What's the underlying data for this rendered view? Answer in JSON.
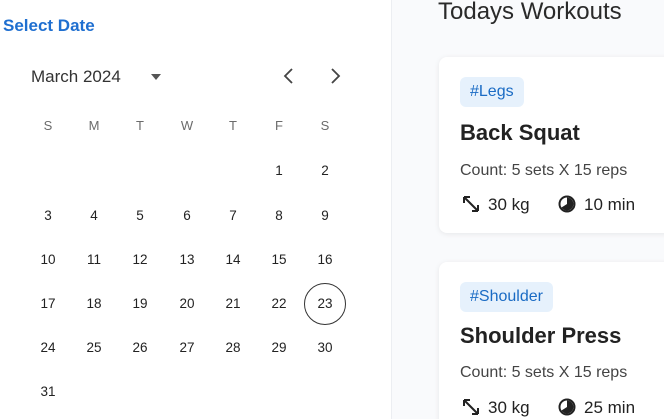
{
  "date_picker": {
    "heading": "Select Date",
    "month_label": "March 2024",
    "weekdays": [
      "S",
      "M",
      "T",
      "W",
      "T",
      "F",
      "S"
    ],
    "weeks": [
      [
        "",
        "",
        "",
        "",
        "",
        "1",
        "2"
      ],
      [
        "3",
        "4",
        "5",
        "6",
        "7",
        "8",
        "9"
      ],
      [
        "10",
        "11",
        "12",
        "13",
        "14",
        "15",
        "16"
      ],
      [
        "17",
        "18",
        "19",
        "20",
        "21",
        "22",
        "23"
      ],
      [
        "24",
        "25",
        "26",
        "27",
        "28",
        "29",
        "30"
      ],
      [
        "31",
        "",
        "",
        "",
        "",
        "",
        ""
      ]
    ],
    "selected_day": "23",
    "icons": {
      "caret": "caret-down-icon",
      "prev": "chevron-left-icon",
      "next": "chevron-right-icon"
    }
  },
  "workouts": {
    "title": "Todays Workouts",
    "items": [
      {
        "tag": "#Legs",
        "name": "Back Squat",
        "count": "Count: 5 sets X 15 reps",
        "weight": "30 kg",
        "duration": "10 min"
      },
      {
        "tag": "#Shoulder",
        "name": "Shoulder Press",
        "count": "Count: 5 sets X 15 reps",
        "weight": "30 kg",
        "duration": "25 min"
      }
    ],
    "icons": {
      "weight": "resize-arrow-icon",
      "time": "timer-icon"
    }
  },
  "colors": {
    "accent": "#1f6fd0",
    "tag_bg": "#e6f1fc",
    "tag_text": "#1a6bc4"
  }
}
